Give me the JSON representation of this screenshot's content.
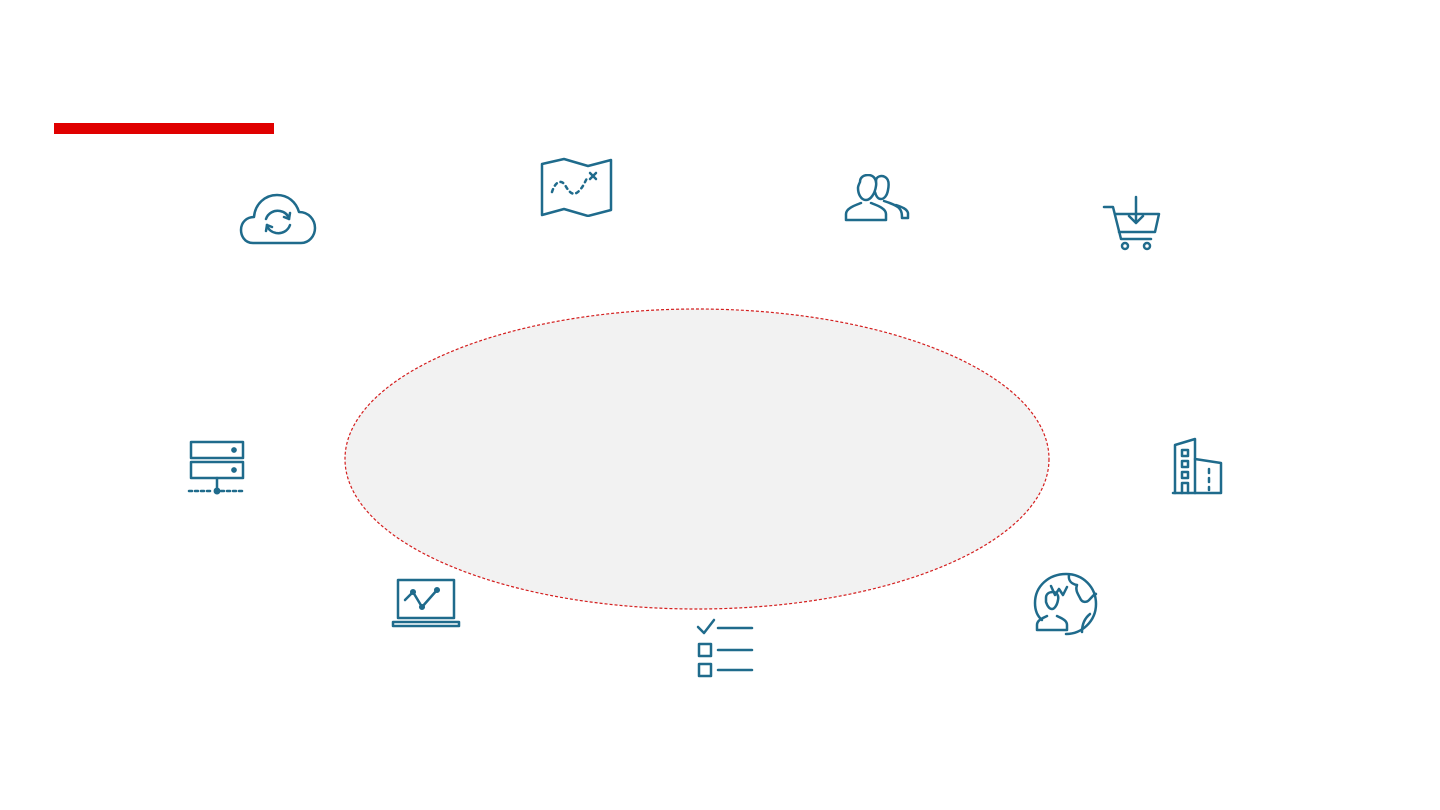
{
  "colors": {
    "accent": "#e00000",
    "icon": "#1f6b8c",
    "ellipse_fill": "#f2f2f2",
    "ellipse_border": "#d41e1e",
    "background": "#ffffff"
  },
  "icons": [
    "cloud-sync-icon",
    "treasure-map-icon",
    "users-icon",
    "cart-download-icon",
    "server-network-icon",
    "office-building-icon",
    "laptop-analytics-icon",
    "checklist-icon",
    "globe-user-icon"
  ]
}
